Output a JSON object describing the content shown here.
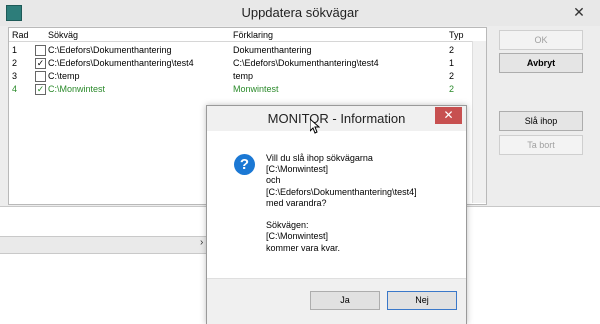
{
  "main_window": {
    "title": "Uppdatera sökvägar",
    "close_glyph": "✕",
    "table": {
      "headers": [
        "Rad",
        "Sökväg",
        "Förklaring",
        "Typ"
      ],
      "rows": [
        {
          "rad": "1",
          "checked": false,
          "path": "C:\\Edefors\\Dokumenthantering",
          "desc": "Dokumenthantering",
          "typ": "2",
          "highlight": false
        },
        {
          "rad": "2",
          "checked": true,
          "path": "C:\\Edefors\\Dokumenthantering\\test4",
          "desc": "C:\\Edefors\\Dokumenthantering\\test4",
          "typ": "1",
          "highlight": false
        },
        {
          "rad": "3",
          "checked": false,
          "path": "C:\\temp",
          "desc": "temp",
          "typ": "2",
          "highlight": false
        },
        {
          "rad": "4",
          "checked": true,
          "path": "C:\\Monwintest",
          "desc": "Monwintest",
          "typ": "2",
          "highlight": true
        }
      ]
    },
    "buttons": {
      "ok": "OK",
      "avbryt": "Avbryt",
      "sla_ihop": "Slå ihop",
      "ta_bort": "Ta bort"
    },
    "lower_arrow": "›"
  },
  "dialog": {
    "title": "MONITOR - Information",
    "close_glyph": "✕",
    "icon": "?",
    "message_lines": [
      "Vill du slå ihop sökvägarna",
      "[C:\\Monwintest]",
      "och",
      "[C:\\Edefors\\Dokumenthantering\\test4]",
      "med varandra?",
      "",
      "Sökvägen:",
      "[C:\\Monwintest]",
      "kommer vara kvar."
    ],
    "buttons": {
      "ja": "Ja",
      "nej": "Nej"
    }
  },
  "colors": {
    "highlight_text": "#2a8a2a",
    "dialog_close": "#c75050",
    "question_icon": "#1b78d4"
  },
  "icons": {
    "app": "app-icon",
    "question": "question-icon",
    "cursor": "mouse-cursor-icon"
  }
}
